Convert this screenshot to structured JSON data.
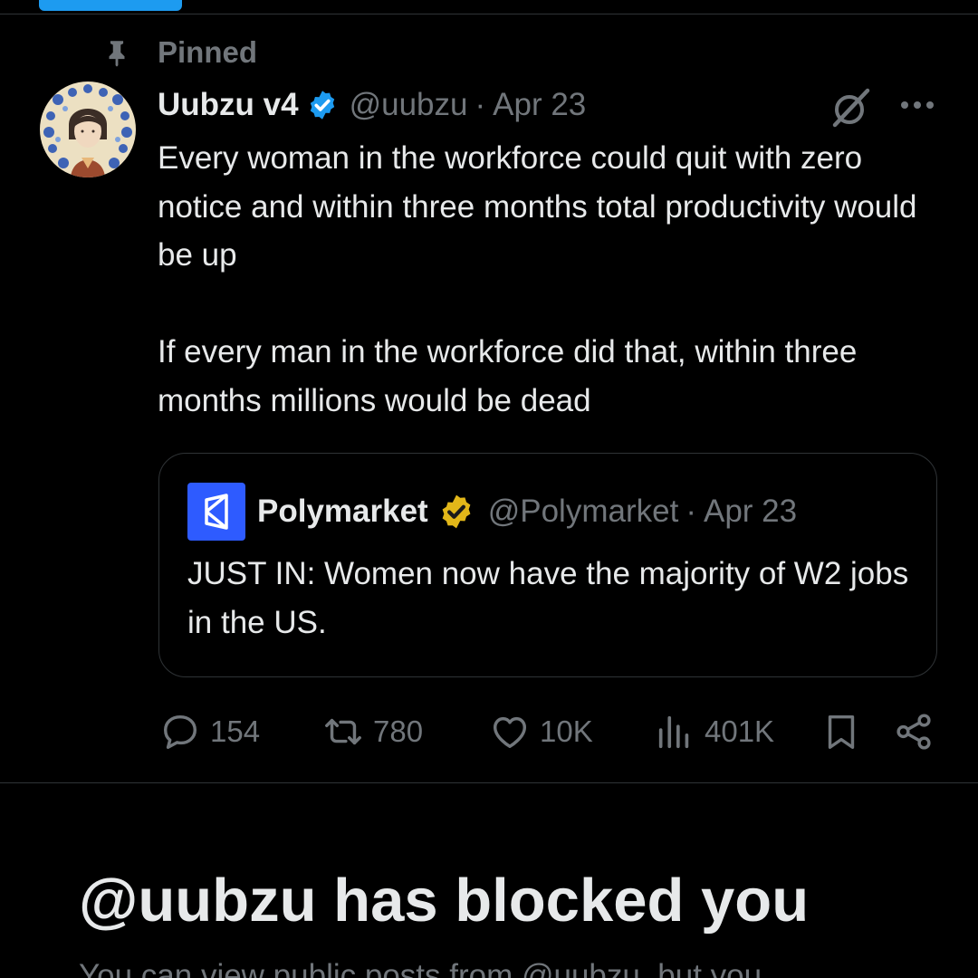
{
  "pinned": {
    "label": "Pinned"
  },
  "post": {
    "author": {
      "display_name": "Uubzu v4",
      "handle": "@uubzu"
    },
    "separator": "·",
    "date": "Apr 23",
    "text": "Every woman in the workforce could quit with zero notice and within three months total productivity would be up\n\nIf every man in the workforce did that, within three months millions would be dead",
    "quote": {
      "author": {
        "display_name": "Polymarket",
        "handle": "@Polymarket"
      },
      "separator": "·",
      "date": "Apr 23",
      "text": "JUST IN: Women now have the majority of W2 jobs in the US."
    },
    "stats": {
      "replies": "154",
      "reposts": "780",
      "likes": "10K",
      "views": "401K"
    }
  },
  "blocked": {
    "title": "@uubzu has blocked you",
    "description": "You can view public posts from @uubzu, but you"
  },
  "colors": {
    "background": "#000000",
    "text_primary": "#e7e9ea",
    "text_secondary": "#71767b",
    "accent": "#1d9bf0",
    "verified_gold": "#e2b719",
    "divider": "#2f3336",
    "polymarket_blue": "#2e5bff"
  },
  "icons": {
    "pinned": "pin-icon",
    "verified": "verified-badge-icon",
    "gold_verified": "gold-verified-badge-icon",
    "grok": "grok-icon",
    "more": "more-icon",
    "reply": "reply-icon",
    "repost": "repost-icon",
    "like": "heart-icon",
    "views": "views-icon",
    "bookmark": "bookmark-icon",
    "share": "share-icon"
  }
}
